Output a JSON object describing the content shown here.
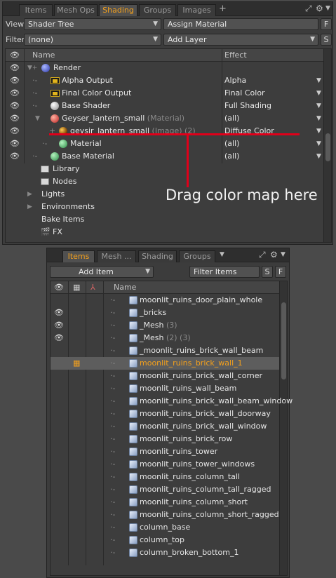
{
  "top_panel": {
    "tabs": [
      "Items",
      "Mesh Ops",
      "Shading",
      "Groups",
      "Images"
    ],
    "active_tab": "Shading",
    "tab_add": "+",
    "view_label": "View",
    "view_value": "Shader Tree",
    "assign_material": "Assign Material",
    "f_button": "F",
    "filter_label": "Filter",
    "filter_value": "(none)",
    "add_layer": "Add Layer",
    "s_button": "S",
    "col_name": "Name",
    "col_effect": "Effect",
    "rows": [
      {
        "name": "Render",
        "suffix": "",
        "effect": ""
      },
      {
        "name": "Alpha Output",
        "suffix": "",
        "effect": "Alpha"
      },
      {
        "name": "Final Color Output",
        "suffix": "",
        "effect": "Final Color"
      },
      {
        "name": "Base Shader",
        "suffix": "",
        "effect": "Full Shading"
      },
      {
        "name": "Geyser_lantern_small",
        "suffix": "(Material)",
        "effect": "(all)"
      },
      {
        "name": "geysir_lantern_small",
        "suffix": "(Image) (2)",
        "effect": "Diffuse Color"
      },
      {
        "name": "Material",
        "suffix": "",
        "effect": "(all)"
      },
      {
        "name": "Base Material",
        "suffix": "",
        "effect": "(all)"
      }
    ],
    "tree_items": [
      "Library",
      "Nodes",
      "Lights",
      "Environments",
      "Bake Items",
      "FX"
    ],
    "annotation": "Drag color map here"
  },
  "bottom_panel": {
    "tabs": [
      "Items",
      "Mesh ...",
      "Shading",
      "Groups"
    ],
    "active_tab": "Items",
    "add_item": "Add Item",
    "filter_items": "Filter Items",
    "s_button": "S",
    "f_button": "F",
    "col_name": "Name",
    "rows": [
      {
        "name": "moonlit_ruins_door_plain_whole",
        "suffix": "",
        "visible": false
      },
      {
        "name": "_bricks",
        "suffix": "",
        "visible": true
      },
      {
        "name": "_Mesh",
        "suffix": "(3)",
        "visible": true
      },
      {
        "name": "_Mesh",
        "suffix": "(2) (3)",
        "visible": true
      },
      {
        "name": "_moonlit_ruins_brick_wall_beam",
        "suffix": "",
        "visible": false
      },
      {
        "name": "moonlit_ruins_brick_wall_1",
        "suffix": "",
        "visible": false,
        "selected": true
      },
      {
        "name": "moonlit_ruins_brick_wall_corner",
        "suffix": "",
        "visible": false
      },
      {
        "name": "moonlit_ruins_wall_beam",
        "suffix": "",
        "visible": false
      },
      {
        "name": "moonlit_ruins_brick_wall_beam_window",
        "suffix": "",
        "visible": false
      },
      {
        "name": "moonlit_ruins_brick_wall_doorway",
        "suffix": "",
        "visible": false
      },
      {
        "name": "moonlit_ruins_brick_wall_window",
        "suffix": "",
        "visible": false
      },
      {
        "name": "moonlit_ruins_brick_row",
        "suffix": "",
        "visible": false
      },
      {
        "name": "moonlit_ruins_tower",
        "suffix": "",
        "visible": false
      },
      {
        "name": "moonlit_ruins_tower_windows",
        "suffix": "",
        "visible": false
      },
      {
        "name": "moonlit_ruins_column_tall",
        "suffix": "",
        "visible": false
      },
      {
        "name": "moonlit_ruins_column_tall_ragged",
        "suffix": "",
        "visible": false
      },
      {
        "name": "moonlit_ruins_column_short",
        "suffix": "",
        "visible": false
      },
      {
        "name": "moonlit_ruins_column_short_ragged",
        "suffix": "",
        "visible": false
      },
      {
        "name": "column_base",
        "suffix": "",
        "visible": false
      },
      {
        "name": "column_top",
        "suffix": "",
        "visible": false
      },
      {
        "name": "column_broken_bottom_1",
        "suffix": "",
        "visible": false
      }
    ]
  },
  "colors": {
    "accent": "#f3a01d",
    "annotation": "#e0001a"
  }
}
